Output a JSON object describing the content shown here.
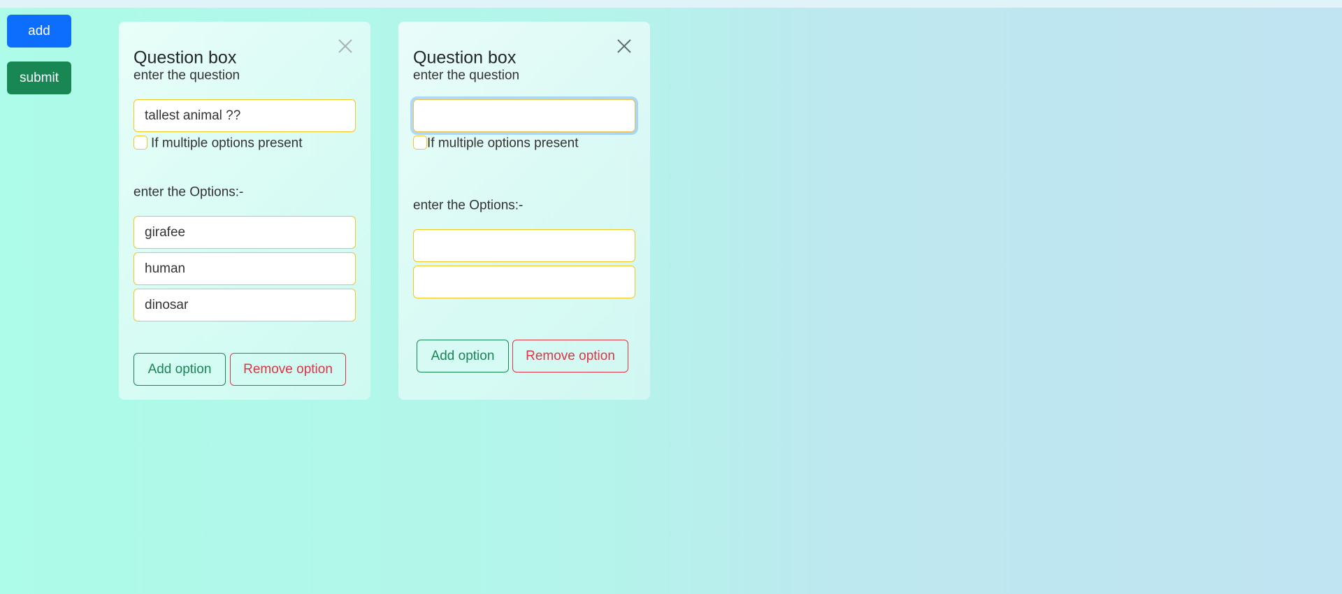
{
  "sidebar": {
    "add_label": "add",
    "submit_label": "submit"
  },
  "cards": [
    {
      "title": "Question box",
      "question_label": "enter the question",
      "question_value": "tallest animal ??",
      "checkbox_label": "If multiple options present",
      "checkbox_checked": false,
      "options_label": "enter the Options:-",
      "options": [
        "girafee",
        "human",
        "dinosar"
      ],
      "add_option_label": "Add option",
      "remove_option_label": "Remove option"
    },
    {
      "title": "Question box",
      "question_label": "enter the question",
      "question_value": "",
      "question_focused": true,
      "checkbox_label": "If multiple options present",
      "checkbox_checked": false,
      "options_label": "enter the Options:-",
      "options": [
        "",
        ""
      ],
      "add_option_label": "Add option",
      "remove_option_label": "Remove option"
    }
  ],
  "colors": {
    "primary": "#0d6efd",
    "success": "#198754",
    "danger": "#dc3545",
    "input_border": "#f3c623"
  }
}
